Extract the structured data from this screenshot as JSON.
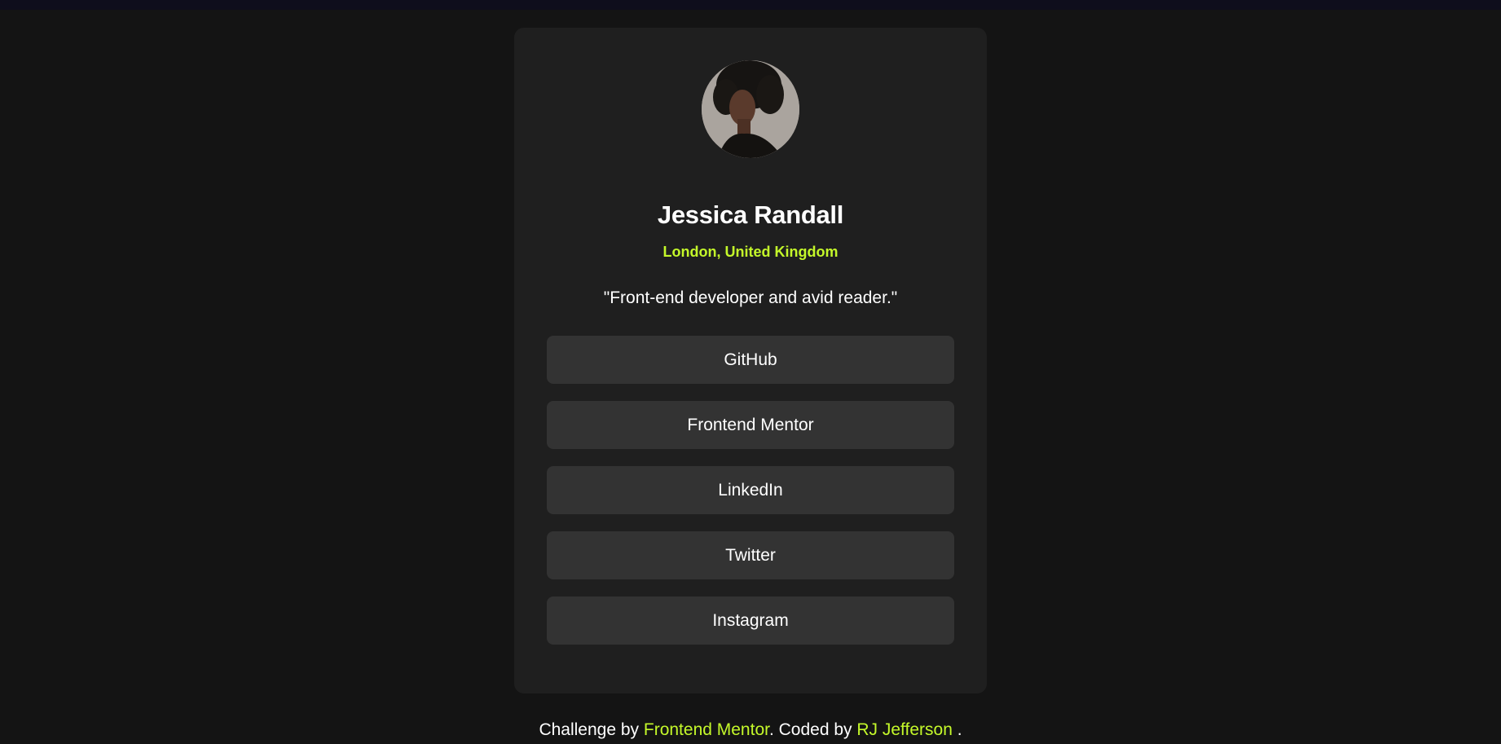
{
  "profile": {
    "name": "Jessica Randall",
    "location": "London, United Kingdom",
    "bio": "\"Front-end developer and avid reader.\"",
    "avatar_alt": "avatar"
  },
  "links": [
    {
      "label": "GitHub"
    },
    {
      "label": "Frontend Mentor"
    },
    {
      "label": "LinkedIn"
    },
    {
      "label": "Twitter"
    },
    {
      "label": "Instagram"
    }
  ],
  "footer": {
    "prefix": "Challenge by ",
    "challenge_link": "Frontend Mentor",
    "middle": ". Coded by ",
    "author_link": "RJ Jefferson",
    "suffix": " ."
  },
  "colors": {
    "accent": "#c4f82a",
    "background": "#141414",
    "card": "#1f1f1f",
    "button": "#333333"
  }
}
